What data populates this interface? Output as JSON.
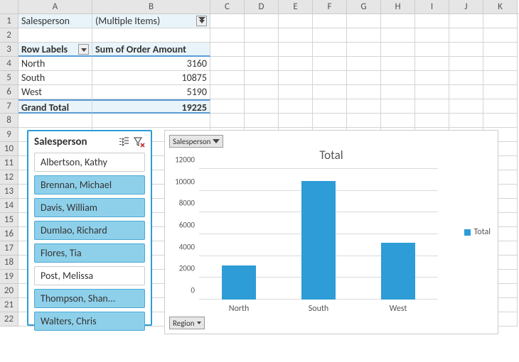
{
  "columns": [
    "A",
    "B",
    "C",
    "D",
    "E",
    "F",
    "G",
    "H",
    "I",
    "J",
    "K"
  ],
  "colWidths": {
    "A": 104,
    "B": 166,
    "other": 48
  },
  "rowCount": 22,
  "pivot": {
    "filter_field": "Salesperson",
    "filter_value": "(Multiple Items)",
    "row_labels_header": "Row Labels",
    "value_header": "Sum of Order Amount",
    "rows": [
      {
        "label": "North",
        "value": 3160
      },
      {
        "label": "South",
        "value": 10875
      },
      {
        "label": "West",
        "value": 5190
      }
    ],
    "total_label": "Grand Total",
    "total_value": 19225
  },
  "slicer": {
    "title": "Salesperson",
    "items": [
      {
        "label": "Albertson, Kathy",
        "selected": false
      },
      {
        "label": "Brennan, Michael",
        "selected": true
      },
      {
        "label": "Davis, William",
        "selected": true
      },
      {
        "label": "Dumlao, Richard",
        "selected": true
      },
      {
        "label": "Flores, Tia",
        "selected": true
      },
      {
        "label": "Post, Melissa",
        "selected": false
      },
      {
        "label": "Thompson, Shan...",
        "selected": true
      },
      {
        "label": "Walters, Chris",
        "selected": true
      }
    ]
  },
  "chart_button_top": "Salesperson",
  "chart_button_bottom": "Region",
  "chart_legend": "Total",
  "chart_data": {
    "type": "bar",
    "title": "Total",
    "categories": [
      "North",
      "South",
      "West"
    ],
    "values": [
      3160,
      10875,
      5190
    ],
    "xlabel": "",
    "ylabel": "",
    "ylim": [
      0,
      12000
    ],
    "ytick": 2000
  },
  "colors": {
    "accent": "#2e9cd6",
    "pivot_bg": "#e8f4fa"
  }
}
